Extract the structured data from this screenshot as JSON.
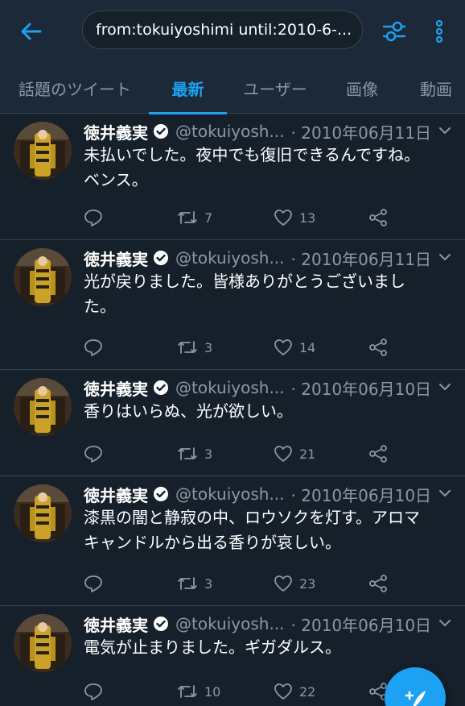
{
  "search": {
    "query": "from:tokuiyoshimi until:2010-6-..."
  },
  "tabs": [
    {
      "label": "話題のツイート",
      "active": false
    },
    {
      "label": "最新",
      "active": true
    },
    {
      "label": "ユーザー",
      "active": false
    },
    {
      "label": "画像",
      "active": false
    },
    {
      "label": "動画",
      "active": false
    }
  ],
  "tweets": [
    {
      "name": "徳井義実",
      "handle": "@tokuiyosh...",
      "date": "· 2010年06月11日",
      "lines": [
        "未払いでした。夜中でも復旧できるんですね。",
        "ベンス。"
      ],
      "retweets": "7",
      "likes": "13"
    },
    {
      "name": "徳井義実",
      "handle": "@tokuiyosh...",
      "date": "· 2010年06月11日",
      "lines": [
        "光が戻りました。皆様ありがとうございまし",
        "た。"
      ],
      "retweets": "3",
      "likes": "14"
    },
    {
      "name": "徳井義実",
      "handle": "@tokuiyosh...",
      "date": "· 2010年06月10日",
      "lines": [
        "香りはいらぬ、光が欲しい。"
      ],
      "retweets": "3",
      "likes": "21"
    },
    {
      "name": "徳井義実",
      "handle": "@tokuiyosh...",
      "date": "· 2010年06月10日",
      "lines": [
        "漆黒の闇と静寂の中、ロウソクを灯す。アロマ",
        "キャンドルから出る香りが哀しい。"
      ],
      "retweets": "3",
      "likes": "23"
    },
    {
      "name": "徳井義実",
      "handle": "@tokuiyosh...",
      "date": "· 2010年06月10日",
      "lines": [
        "電気が止まりました。ギガダルス。"
      ],
      "retweets": "10",
      "likes": "22"
    }
  ],
  "colors": {
    "background": "#15202b",
    "bar": "#1c2938",
    "accent": "#1da1f2",
    "muted": "#8899a6",
    "divider": "#38444d"
  },
  "icons": [
    "back-arrow-icon",
    "filter-sliders-icon",
    "more-vertical-icon",
    "verified-badge-icon",
    "chevron-down-icon",
    "reply-icon",
    "retweet-icon",
    "like-heart-icon",
    "share-icon",
    "compose-tweet-icon"
  ]
}
